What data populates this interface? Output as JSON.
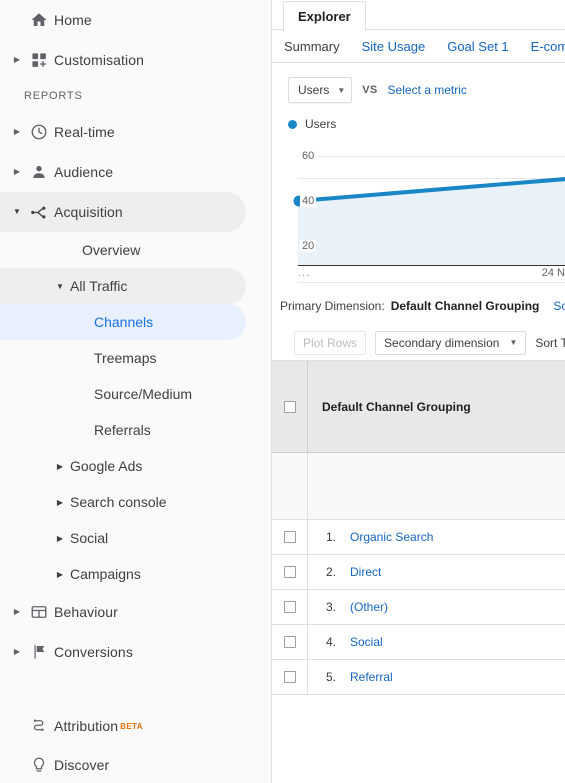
{
  "sidebar": {
    "top_items": [
      {
        "label": "Home",
        "icon": "home-icon",
        "arrow": "none"
      },
      {
        "label": "Customisation",
        "icon": "customisation-icon",
        "arrow": "right"
      }
    ],
    "section_label": "REPORTS",
    "report_items": [
      {
        "label": "Real-time",
        "icon": "clock-icon",
        "arrow": "right",
        "state": ""
      },
      {
        "label": "Audience",
        "icon": "person-icon",
        "arrow": "right",
        "state": ""
      },
      {
        "label": "Acquisition",
        "icon": "acquisition-icon",
        "arrow": "down",
        "state": "active"
      }
    ],
    "acquisition_children": [
      {
        "label": "Overview",
        "arrow": "none",
        "indent": 66,
        "state": ""
      },
      {
        "label": "All Traffic",
        "arrow": "down",
        "indent": 54,
        "state": "active"
      },
      {
        "label": "Channels",
        "arrow": "none",
        "indent": 78,
        "state": "selected"
      },
      {
        "label": "Treemaps",
        "arrow": "none",
        "indent": 78,
        "state": ""
      },
      {
        "label": "Source/Medium",
        "arrow": "none",
        "indent": 78,
        "state": ""
      },
      {
        "label": "Referrals",
        "arrow": "none",
        "indent": 78,
        "state": ""
      },
      {
        "label": "Google Ads",
        "arrow": "right",
        "indent": 54,
        "state": ""
      },
      {
        "label": "Search console",
        "arrow": "right",
        "indent": 54,
        "state": ""
      },
      {
        "label": "Social",
        "arrow": "right",
        "indent": 54,
        "state": ""
      },
      {
        "label": "Campaigns",
        "arrow": "right",
        "indent": 54,
        "state": ""
      }
    ],
    "bottom_items": [
      {
        "label": "Behaviour",
        "icon": "behaviour-icon",
        "arrow": "right"
      },
      {
        "label": "Conversions",
        "icon": "flag-icon",
        "arrow": "right"
      }
    ],
    "footer_items": [
      {
        "label": "Attribution",
        "icon": "attribution-icon",
        "badge": "BETA"
      },
      {
        "label": "Discover",
        "icon": "bulb-icon",
        "badge": ""
      }
    ]
  },
  "tabs": {
    "explorer_label": "Explorer",
    "subtabs": [
      {
        "label": "Summary",
        "active": true
      },
      {
        "label": "Site Usage",
        "active": false
      },
      {
        "label": "Goal Set 1",
        "active": false
      },
      {
        "label": "E-comme",
        "active": false
      }
    ]
  },
  "metric_row": {
    "selected_metric": "Users",
    "vs_label": "VS",
    "select_metric_link": "Select a metric"
  },
  "legend": {
    "series_name": "Users",
    "color": "#1a86c8"
  },
  "chart_data": {
    "type": "area",
    "title": "Users",
    "series": [
      {
        "name": "Users",
        "values": [
          40,
          52
        ],
        "color": "#1a86c8"
      }
    ],
    "x": [
      "...",
      "24 N"
    ],
    "xlabel": "",
    "ylabel": "",
    "yticks": [
      20,
      40,
      60
    ],
    "ylim": [
      0,
      70
    ],
    "grid": true,
    "legend_position": "top-left",
    "x_tick_labels": {
      "left": "...",
      "right": "24 N"
    }
  },
  "primary_dimension": {
    "label": "Primary Dimension:",
    "active": "Default Channel Grouping",
    "links": [
      "Source,"
    ]
  },
  "toolbar": {
    "plot_rows_label": "Plot Rows",
    "secondary_dimension_label": "Secondary dimension",
    "sort_type_label": "Sort Type:"
  },
  "table": {
    "column_header": "Default Channel Grouping",
    "rows": [
      {
        "num": "1.",
        "label": "Organic Search"
      },
      {
        "num": "2.",
        "label": "Direct"
      },
      {
        "num": "3.",
        "label": "(Other)"
      },
      {
        "num": "4.",
        "label": "Social"
      },
      {
        "num": "5.",
        "label": "Referral"
      }
    ]
  },
  "colors": {
    "accent_blue": "#1a73e8",
    "link_blue": "#1565c0",
    "chart_blue": "#1a86c8",
    "chart_fill": "#e8f2f8",
    "selected_bg": "#e8f0fe",
    "active_bg": "#eeeeee",
    "beta_orange": "#e8710a"
  }
}
